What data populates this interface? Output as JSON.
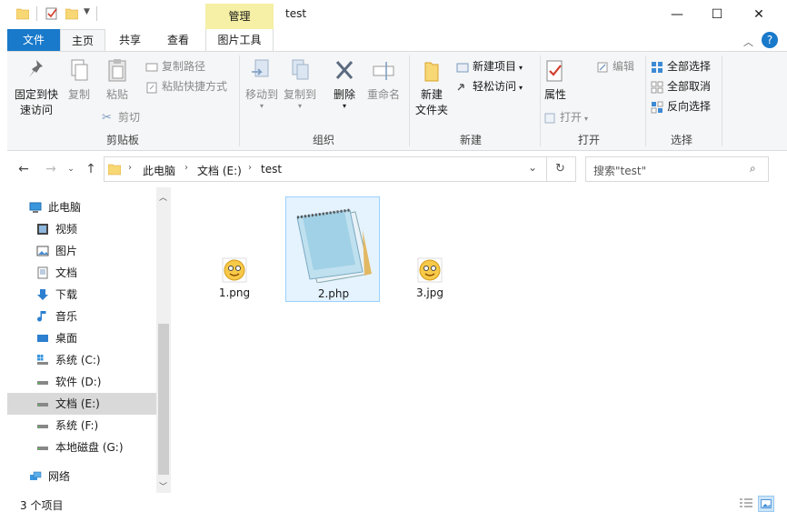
{
  "titlebar": {
    "manage_tab": "管理",
    "title": "test",
    "minimize": "—",
    "maximize": "☐",
    "close": "✕"
  },
  "tabs": {
    "file": "文件",
    "home": "主页",
    "share": "共享",
    "view": "查看",
    "picture_tools": "图片工具",
    "help": "?"
  },
  "ribbon": {
    "clipboard": {
      "pin_quick_access_line1": "固定到快",
      "pin_quick_access_line2": "速访问",
      "copy": "复制",
      "paste": "粘贴",
      "copy_path": "复制路径",
      "paste_shortcut": "粘贴快捷方式",
      "cut": "剪切",
      "group_label": "剪贴板"
    },
    "organize": {
      "move_to": "移动到",
      "copy_to": "复制到",
      "delete": "删除",
      "rename": "重命名",
      "group_label": "组织"
    },
    "new": {
      "new_folder_line1": "新建",
      "new_folder_line2": "文件夹",
      "new_item": "新建项目",
      "easy_access": "轻松访问",
      "group_label": "新建"
    },
    "open": {
      "properties": "属性",
      "open": "打开",
      "edit": "编辑",
      "group_label": "打开"
    },
    "select": {
      "select_all": "全部选择",
      "select_none": "全部取消",
      "invert_selection": "反向选择",
      "group_label": "选择"
    }
  },
  "address": {
    "path": [
      "此电脑",
      "文档 (E:)",
      "test"
    ],
    "search_placeholder": "搜索\"test\""
  },
  "navpane": {
    "items": [
      {
        "label": "此电脑",
        "icon": "monitor-icon"
      },
      {
        "label": "视频",
        "icon": "video-icon"
      },
      {
        "label": "图片",
        "icon": "picture-icon"
      },
      {
        "label": "文档",
        "icon": "document-icon"
      },
      {
        "label": "下载",
        "icon": "download-icon"
      },
      {
        "label": "音乐",
        "icon": "music-icon"
      },
      {
        "label": "桌面",
        "icon": "desktop-icon"
      },
      {
        "label": "系统 (C:)",
        "icon": "drive-icon"
      },
      {
        "label": "软件 (D:)",
        "icon": "drive-icon"
      },
      {
        "label": "文档 (E:)",
        "icon": "drive-icon"
      },
      {
        "label": "系统 (F:)",
        "icon": "drive-icon"
      },
      {
        "label": "本地磁盘 (G:)",
        "icon": "drive-icon"
      },
      {
        "label": "网络",
        "icon": "network-icon"
      }
    ],
    "selected_index": 9
  },
  "files": [
    {
      "name": "1.png",
      "icon": "smiley-icon"
    },
    {
      "name": "2.php",
      "icon": "notepad-icon"
    },
    {
      "name": "3.jpg",
      "icon": "smiley-icon"
    }
  ],
  "status": {
    "count": "3 个项目"
  },
  "colors": {
    "accent": "#1979ca",
    "manage_tab_bg": "#f5f0a5",
    "selection_bg": "#e5f3ff",
    "selection_border": "#99d1ff"
  }
}
